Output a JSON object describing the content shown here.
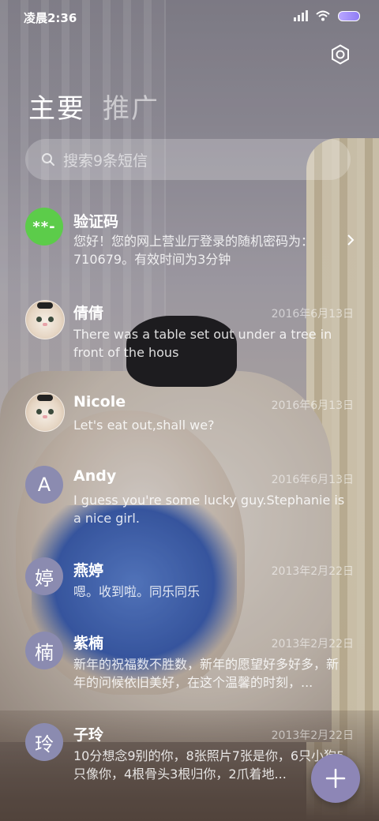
{
  "status_bar": {
    "time": "凌晨2:36"
  },
  "header": {
    "tabs": [
      {
        "label": "主要"
      },
      {
        "label": "推广"
      }
    ],
    "settings_icon": "settings-icon"
  },
  "search": {
    "placeholder": "搜索9条短信"
  },
  "messages": [
    {
      "name": "验证码",
      "avatar_text": "**-",
      "date": "",
      "preview": "您好！您的网上营业厅登录的随机密码为：710679。有效时间为3分钟"
    },
    {
      "name": "倩倩",
      "avatar_text": "",
      "date": "2016年6月13日",
      "preview": "There was a table set out under a tree in front of the hous"
    },
    {
      "name": "Nicole",
      "avatar_text": "",
      "date": "2016年6月13日",
      "preview": "Let's eat out,shall we?"
    },
    {
      "name": "Andy",
      "avatar_text": "A",
      "date": "2016年6月13日",
      "preview": "I guess you're some lucky guy.Stephanie is a nice girl."
    },
    {
      "name": "燕婷",
      "avatar_text": "婷",
      "date": "2013年2月22日",
      "preview": "嗯。收到啦。同乐同乐"
    },
    {
      "name": "紫楠",
      "avatar_text": "楠",
      "date": "2013年2月22日",
      "preview": "新年的祝福数不胜数，新年的愿望好多好多，新年的问候依旧美好，在这个温馨的时刻，..."
    },
    {
      "name": "子玲",
      "avatar_text": "玲",
      "date": "2013年2月22日",
      "preview": "10分想念9别的你，8张照片7张是你，6只小狗5只像你，4根骨头3根归你，2爪着地..."
    }
  ],
  "colors": {
    "green_avatar": "#5ccc4a",
    "letter_avatar": "#8b8bb0",
    "fab": "#8d86b6"
  }
}
